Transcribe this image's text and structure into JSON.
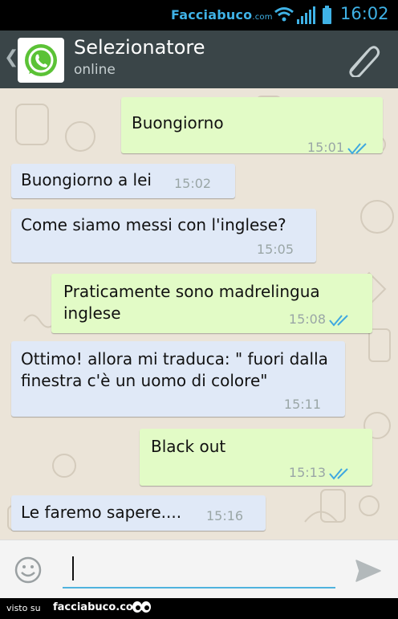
{
  "status_bar": {
    "brand_main": "Facciabuco",
    "brand_suffix": ".com",
    "time": "16:02",
    "icons": [
      "wifi-icon",
      "signal-icon",
      "battery-icon"
    ]
  },
  "header": {
    "back_glyph": "❮",
    "title": "Selezionatore",
    "subtitle": "online",
    "icons": [
      "whatsapp-icon",
      "paperclip-icon"
    ]
  },
  "messages": [
    {
      "direction": "out",
      "text": "Buongiorno",
      "time": "15:01",
      "read": true
    },
    {
      "direction": "in",
      "text": "Buongiorno a lei",
      "time": "15:02"
    },
    {
      "direction": "in",
      "text": "Come siamo messi con l'inglese?",
      "time": "15:05"
    },
    {
      "direction": "out",
      "text": "Praticamente sono madrelingua inglese",
      "time": "15:08",
      "read": true
    },
    {
      "direction": "in",
      "text": "Ottimo! allora mi traduca: \" fuori dalla finestra c'è un uomo di colore\"",
      "time": "15:11"
    },
    {
      "direction": "out",
      "text": "Black out",
      "time": "15:13",
      "read": true
    },
    {
      "direction": "in",
      "text": "Le faremo sapere....",
      "time": "15:16"
    }
  ],
  "composer": {
    "icons": [
      "emoji-icon",
      "send-icon"
    ]
  },
  "footer": {
    "visto": "visto su",
    "site": "facciabuco.com"
  },
  "colors": {
    "header": "#3a4548",
    "outgoing": "#e2fbc6",
    "incoming": "#e0e9f7",
    "background": "#ebe4d8",
    "accent": "#3fb2e6"
  }
}
